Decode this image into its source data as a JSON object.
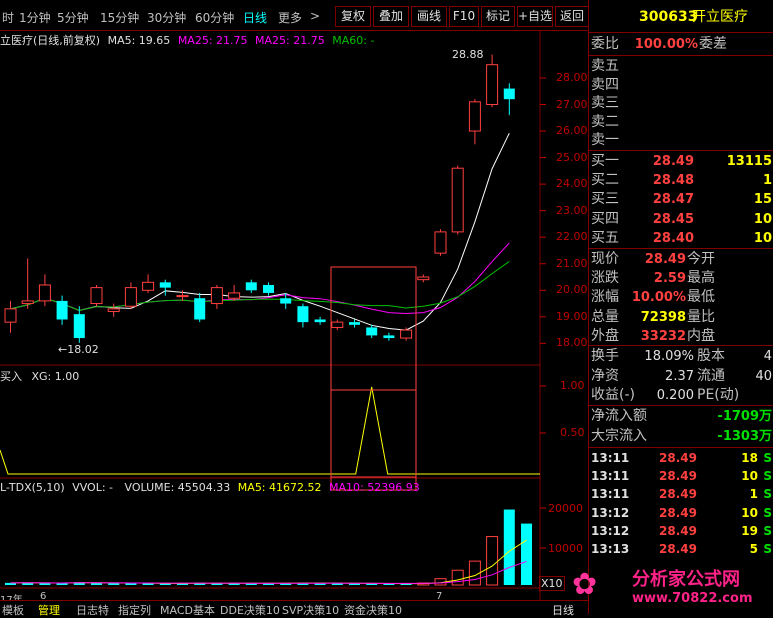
{
  "toolbar": {
    "periods": [
      "1分钟",
      "5分钟",
      "15分钟",
      "30分钟",
      "60分钟",
      "日线",
      "更多"
    ],
    "more_arrow": ">",
    "active_period": "日线",
    "buttons": [
      "复权",
      "叠加",
      "画线",
      "F10",
      "标记",
      "+自选",
      "返回"
    ],
    "prefix": "时"
  },
  "chart": {
    "legend": {
      "title": "立医疗(日线,前复权)",
      "ma5": "MA5: 19.65",
      "ma25a": "MA25: 21.75",
      "ma25b": "MA25: 21.75",
      "ma60": "MA60: -"
    },
    "price_labels": [
      "28.00",
      "27.00",
      "26.00",
      "25.00",
      "24.00",
      "23.00",
      "22.00",
      "21.00",
      "20.00",
      "19.00",
      "18.00"
    ],
    "high_marker": "28.88",
    "low_marker": "←18.02",
    "indicator_legend": {
      "name": "买入",
      "xg": "XG: 1.00"
    },
    "indicator_labels": [
      "1.00",
      "0.50"
    ],
    "volume_legend": {
      "name": "L-TDX(5,10)",
      "vol": "VVOL: -",
      "volume": "VOLUME: 45504.33",
      "ma5": "MA5: 41672.52",
      "ma10": "MA10: 52396.93"
    },
    "volume_labels": [
      "20000",
      "10000"
    ],
    "volume_unit": "X10",
    "x_labels": [
      "17年",
      "6",
      "7"
    ],
    "colors": {
      "up": "#ff4040",
      "down": "#00ffff",
      "ma5": "#ffffff",
      "ma25": "#ff00ff",
      "ma60": "#00c000",
      "ma10": "#ffff00"
    }
  },
  "chart_data": {
    "type": "candlestick",
    "candles": [
      {
        "o": 18.8,
        "c": 19.3,
        "h": 19.6,
        "l": 18.4
      },
      {
        "o": 19.5,
        "c": 19.6,
        "h": 21.2,
        "l": 19.3
      },
      {
        "o": 19.6,
        "c": 20.2,
        "h": 20.6,
        "l": 19.4
      },
      {
        "o": 19.6,
        "c": 18.9,
        "h": 19.8,
        "l": 18.7
      },
      {
        "o": 19.1,
        "c": 18.2,
        "h": 19.4,
        "l": 18.02
      },
      {
        "o": 19.5,
        "c": 20.1,
        "h": 20.2,
        "l": 19.4
      },
      {
        "o": 19.2,
        "c": 19.3,
        "h": 19.5,
        "l": 19.0
      },
      {
        "o": 19.4,
        "c": 20.1,
        "h": 20.3,
        "l": 19.3
      },
      {
        "o": 20.0,
        "c": 20.3,
        "h": 20.6,
        "l": 19.9
      },
      {
        "o": 20.3,
        "c": 20.1,
        "h": 20.4,
        "l": 19.8
      },
      {
        "o": 19.8,
        "c": 19.8,
        "h": 20.0,
        "l": 19.6
      },
      {
        "o": 19.7,
        "c": 18.9,
        "h": 19.9,
        "l": 18.8
      },
      {
        "o": 19.5,
        "c": 20.1,
        "h": 20.2,
        "l": 19.3
      },
      {
        "o": 19.7,
        "c": 19.9,
        "h": 20.2,
        "l": 19.6
      },
      {
        "o": 20.3,
        "c": 20.0,
        "h": 20.4,
        "l": 19.9
      },
      {
        "o": 20.2,
        "c": 19.9,
        "h": 20.3,
        "l": 19.8
      },
      {
        "o": 19.7,
        "c": 19.5,
        "h": 19.9,
        "l": 19.3
      },
      {
        "o": 19.4,
        "c": 18.8,
        "h": 19.5,
        "l": 18.6
      },
      {
        "o": 18.9,
        "c": 18.8,
        "h": 19.0,
        "l": 18.7
      },
      {
        "o": 18.6,
        "c": 18.8,
        "h": 18.9,
        "l": 18.5
      },
      {
        "o": 18.8,
        "c": 18.7,
        "h": 18.9,
        "l": 18.6
      },
      {
        "o": 18.6,
        "c": 18.3,
        "h": 18.7,
        "l": 18.2
      },
      {
        "o": 18.3,
        "c": 18.2,
        "h": 18.4,
        "l": 18.1
      },
      {
        "o": 18.2,
        "c": 18.5,
        "h": 18.6,
        "l": 18.1
      },
      {
        "o": 20.4,
        "c": 20.5,
        "h": 20.6,
        "l": 20.3
      },
      {
        "o": 21.4,
        "c": 22.2,
        "h": 22.3,
        "l": 21.3
      },
      {
        "o": 22.2,
        "c": 24.6,
        "h": 24.7,
        "l": 22.1
      },
      {
        "o": 26.0,
        "c": 27.1,
        "h": 27.2,
        "l": 25.5
      },
      {
        "o": 27.0,
        "c": 28.5,
        "h": 28.88,
        "l": 26.9
      },
      {
        "o": 27.6,
        "c": 27.2,
        "h": 27.8,
        "l": 26.6
      }
    ],
    "volumes": [
      600,
      700,
      550,
      500,
      800,
      600,
      500,
      450,
      400,
      420,
      500,
      650,
      480,
      430,
      520,
      500,
      560,
      600,
      500,
      450,
      420,
      400,
      380,
      360,
      350,
      1800,
      4200,
      6800,
      13800,
      21500,
      17500
    ],
    "indicator_signal_index": 21
  },
  "quote": {
    "code": "300633",
    "name": "开立医疗",
    "weibi_label": "委比",
    "weibi": "100.00%",
    "weicha_label": "委差",
    "weicha": "",
    "sells": [
      {
        "label": "卖五",
        "price": "",
        "vol": ""
      },
      {
        "label": "卖四",
        "price": "",
        "vol": ""
      },
      {
        "label": "卖三",
        "price": "",
        "vol": ""
      },
      {
        "label": "卖二",
        "price": "",
        "vol": ""
      },
      {
        "label": "卖一",
        "price": "",
        "vol": ""
      }
    ],
    "buys": [
      {
        "label": "买一",
        "price": "28.49",
        "vol": "13115"
      },
      {
        "label": "买二",
        "price": "28.48",
        "vol": "1"
      },
      {
        "label": "买三",
        "price": "28.47",
        "vol": "15"
      },
      {
        "label": "买四",
        "price": "28.45",
        "vol": "10"
      },
      {
        "label": "买五",
        "price": "28.40",
        "vol": "10"
      }
    ],
    "stats": [
      {
        "l1": "现价",
        "v1": "28.49",
        "c1": "red",
        "l2": "今开",
        "v2": "",
        "c2": "red"
      },
      {
        "l1": "涨跌",
        "v1": "2.59",
        "c1": "red",
        "l2": "最高",
        "v2": "",
        "c2": "red"
      },
      {
        "l1": "涨幅",
        "v1": "10.00%",
        "c1": "red",
        "l2": "最低",
        "v2": "",
        "c2": "red"
      },
      {
        "l1": "总量",
        "v1": "72398",
        "c1": "yellow",
        "l2": "量比",
        "v2": "",
        "c2": "red"
      },
      {
        "l1": "外盘",
        "v1": "33232",
        "c1": "red",
        "l2": "内盘",
        "v2": "",
        "c2": "green"
      }
    ],
    "stats2": [
      {
        "l1": "换手",
        "v1": "18.09%",
        "l2": "股本",
        "v2": "4"
      },
      {
        "l1": "净资",
        "v1": "2.37",
        "l2": "流通",
        "v2": "40"
      },
      {
        "l1": "收益(-)",
        "v1": "0.200",
        "l2": "PE(动)",
        "v2": ""
      }
    ],
    "flows": [
      {
        "label": "净流入额",
        "value": "-1709万"
      },
      {
        "label": "大宗流入",
        "value": "-1303万"
      }
    ],
    "ticks": [
      {
        "time": "13:11",
        "price": "28.49",
        "vol": "18",
        "flag": "S"
      },
      {
        "time": "13:11",
        "price": "28.49",
        "vol": "10",
        "flag": "S"
      },
      {
        "time": "13:11",
        "price": "28.49",
        "vol": "1",
        "flag": "S"
      },
      {
        "time": "13:12",
        "price": "28.49",
        "vol": "10",
        "flag": "S"
      },
      {
        "time": "13:12",
        "price": "28.49",
        "vol": "19",
        "flag": "S"
      },
      {
        "time": "13:13",
        "price": "28.49",
        "vol": "5",
        "flag": "S"
      }
    ]
  },
  "bottom_tabs": [
    "模板",
    "管理",
    "日志特",
    "指定列",
    "MACD基本",
    "DDE决策10",
    "SVP决策10",
    "资金决策10"
  ],
  "bottom_right": "日线",
  "watermark": {
    "text": "分析家公式网",
    "url": "www.70822.com"
  }
}
